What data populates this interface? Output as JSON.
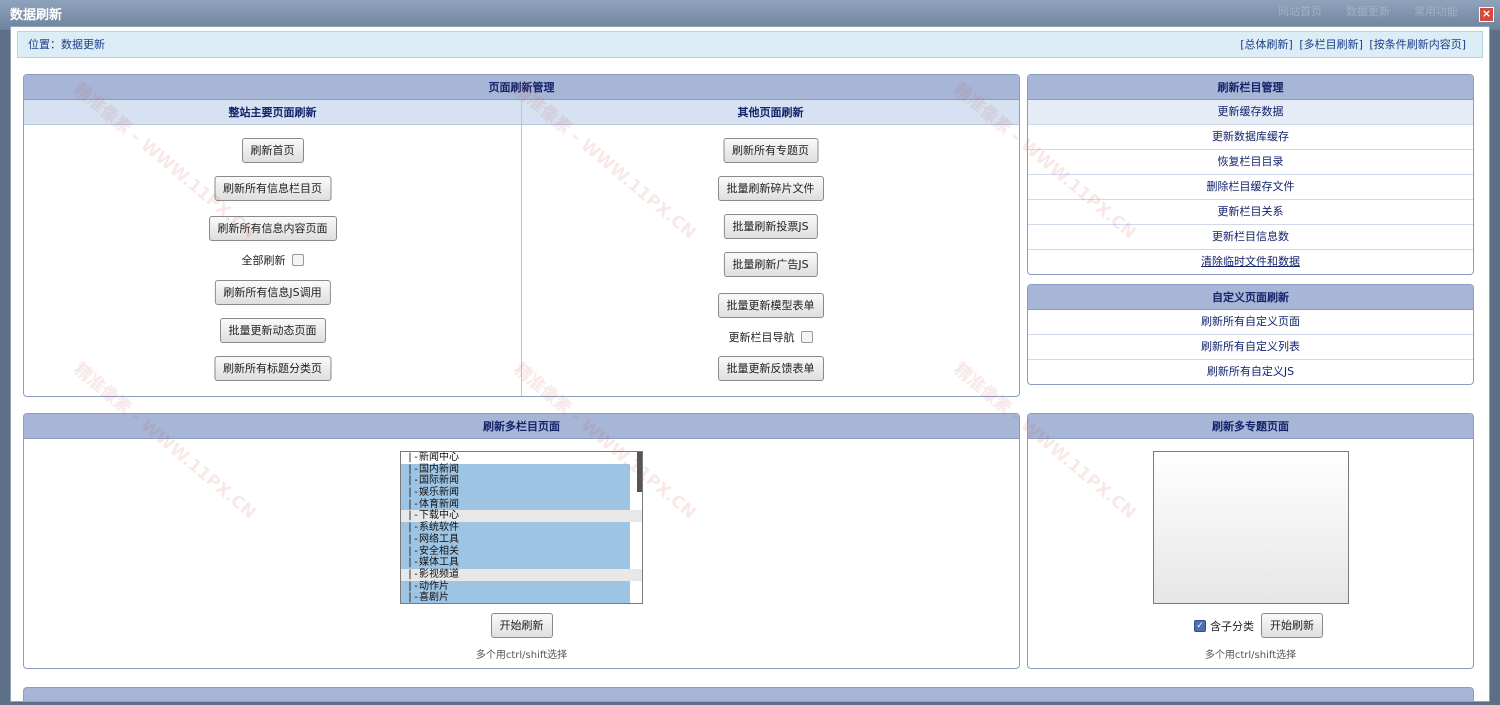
{
  "window": {
    "title": "数据刷新",
    "close": "×"
  },
  "bg_tabs": [
    "网站首页",
    "数据更新",
    "常用功能"
  ],
  "breadcrumb": {
    "label": "位置：",
    "current": "数据更新",
    "links": [
      "[总体刷新]",
      "[多栏目刷新]",
      "[按条件刷新内容页]"
    ]
  },
  "page_refresh": {
    "title": "页面刷新管理",
    "left_title": "整站主要页面刷新",
    "right_title": "其他页面刷新",
    "left_buttons": [
      "刷新首页",
      "刷新所有信息栏目页",
      "刷新所有信息内容页面",
      "刷新所有信息JS调用",
      "批量更新动态页面",
      "刷新所有标题分类页"
    ],
    "left_check": "全部刷新",
    "right_buttons": [
      "刷新所有专题页",
      "批量刷新碎片文件",
      "批量刷新投票JS",
      "批量刷新广告JS",
      "批量更新模型表单",
      "批量更新反馈表单"
    ],
    "right_check": "更新栏目导航"
  },
  "column_mgmt": {
    "title": "刷新栏目管理",
    "items": [
      "更新缓存数据",
      "更新数据库缓存",
      "恢复栏目目录",
      "删除栏目缓存文件",
      "更新栏目关系",
      "更新栏目信息数",
      "清除临时文件和数据"
    ]
  },
  "custom_pages": {
    "title": "自定义页面刷新",
    "items": [
      "刷新所有自定义页面",
      "刷新所有自定义列表",
      "刷新所有自定义JS"
    ]
  },
  "multi_column": {
    "title": "刷新多栏目页面",
    "options": [
      "|-新闻中心",
      "  |-国内新闻",
      "  |-国际新闻",
      "  |-娱乐新闻",
      "  |-体育新闻",
      "|-下载中心",
      "  |-系统软件",
      "  |-网络工具",
      "  |-安全相关",
      "  |-媒体工具",
      "|-影视频道",
      "  |-动作片",
      "  |-喜剧片"
    ],
    "button": "开始刷新",
    "hint": "多个用ctrl/shift选择"
  },
  "multi_topic": {
    "title": "刷新多专题页面",
    "checkbox": "含子分类",
    "button": "开始刷新",
    "hint": "多个用ctrl/shift选择"
  },
  "watermark": "精准像素 - WWW.11PX.CN"
}
